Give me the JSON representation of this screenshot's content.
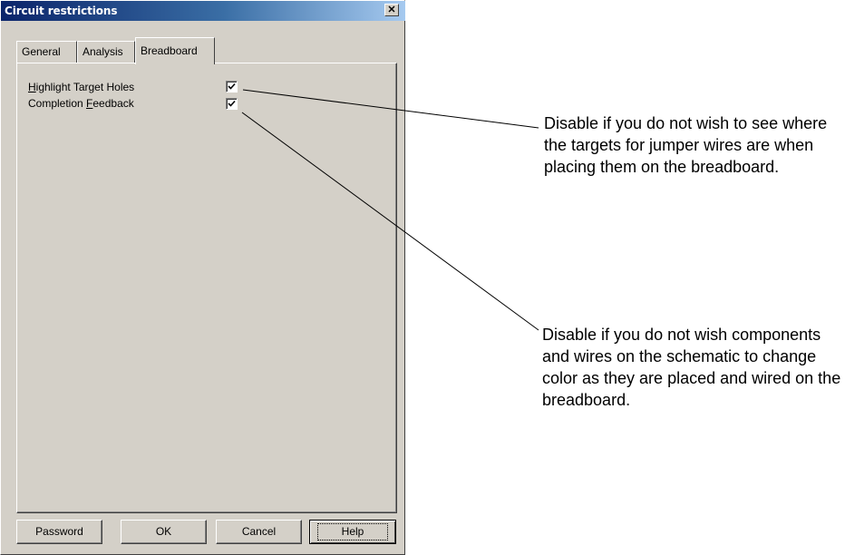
{
  "window": {
    "title": "Circuit restrictions",
    "close_glyph": "✕"
  },
  "tabs": [
    {
      "label": "General",
      "active": false
    },
    {
      "label": "Analysis",
      "active": false
    },
    {
      "label": "Breadboard",
      "active": true
    }
  ],
  "options": [
    {
      "mnemonic": "H",
      "label_rest": "ighlight Target Holes",
      "checked": true
    },
    {
      "prefix": "Completion ",
      "mnemonic": "F",
      "label_rest": "eedback",
      "checked": true
    }
  ],
  "buttons": {
    "password": "Password",
    "ok": "OK",
    "cancel": "Cancel",
    "help": "Help"
  },
  "annotations": [
    "Disable if you do not wish to see where the targets for jumper wires are when placing them on the breadboard.",
    "Disable if you do not wish components and wires on the schematic to change color as they are placed and wired on the breadboard."
  ],
  "colors": {
    "dialog_face": "#d4d0c8",
    "titlebar_start": "#0a246a",
    "titlebar_end": "#a6caf0"
  }
}
